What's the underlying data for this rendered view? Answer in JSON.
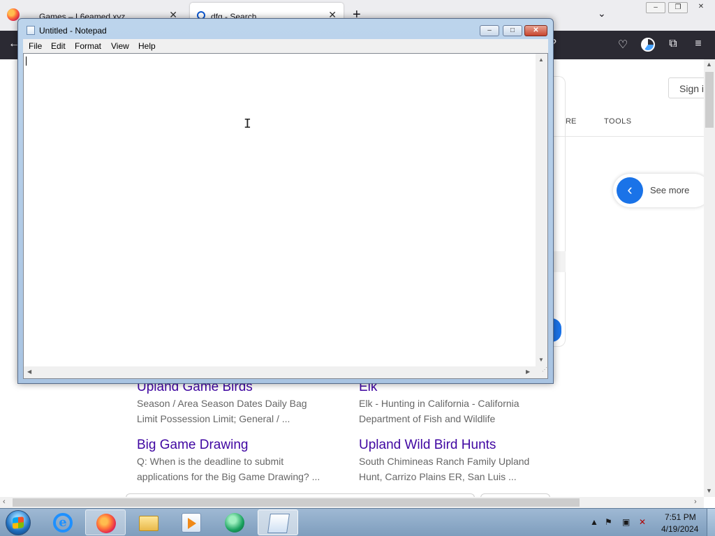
{
  "browser": {
    "tabs": [
      {
        "title": "Games – L6eamed.xyz"
      },
      {
        "title": "dfg - Search"
      }
    ],
    "window_controls": {
      "minimize": "–",
      "restore": "❐",
      "close": "✕"
    }
  },
  "bing": {
    "sign_in": "Sign i",
    "nav_tab_partial": "RE",
    "tools_label": "TOOLS",
    "see_more": "See more",
    "results": [
      {
        "title": "Upland Game Birds",
        "desc1": "Season / Area Season Dates Daily Bag",
        "desc2": "Limit Possession Limit; General / ..."
      },
      {
        "title": "Elk",
        "desc1": "Elk - Hunting in California - California",
        "desc2": "Department of Fish and Wildlife"
      },
      {
        "title": "Big Game Drawing",
        "desc1": "Q: When is the deadline to submit",
        "desc2": "applications for the Big Game Drawing? ..."
      },
      {
        "title": "Upland Wild Bird Hunts",
        "desc1": "South Chimineas Ranch Family Upland",
        "desc2": "Hunt, Carrizo Plains ER, San Luis ..."
      }
    ]
  },
  "notepad": {
    "title": "Untitled - Notepad",
    "menu": [
      "File",
      "Edit",
      "Format",
      "View",
      "Help"
    ],
    "content": ""
  },
  "taskbar": {
    "apps": [
      {
        "name": "internet-explorer-icon"
      },
      {
        "name": "firefox-icon"
      },
      {
        "name": "file-explorer-icon"
      },
      {
        "name": "media-player-icon"
      },
      {
        "name": "browser-globe-icon"
      },
      {
        "name": "notepad-icon"
      }
    ],
    "clock": {
      "time": "7:51 PM",
      "date": "4/19/2024"
    }
  }
}
